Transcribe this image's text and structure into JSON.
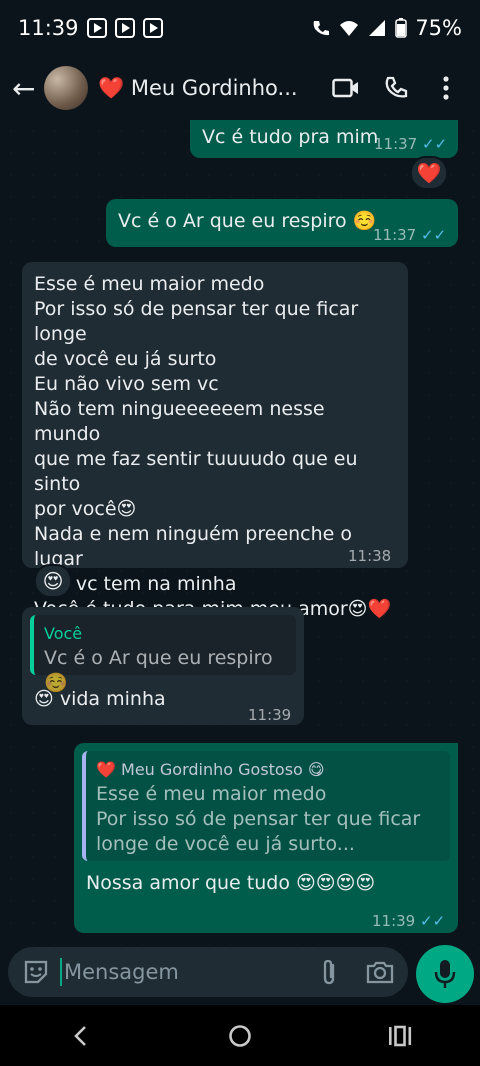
{
  "status_bar": {
    "time": "11:39",
    "battery": "75%"
  },
  "header": {
    "contact_name": "Meu Gordinho...",
    "heart": "❤️"
  },
  "messages": {
    "m1": {
      "text": "Vc é tudo pra mim",
      "time": "11:37",
      "ticks": "✓✓"
    },
    "m1_reaction": "❤️",
    "m2": {
      "text": "Vc é o Ar que eu respiro ☺️",
      "time": "11:37",
      "ticks": "✓✓"
    },
    "m3": {
      "l1": "Esse é meu maior medo",
      "l2": "Por isso só de pensar ter que ficar longe",
      "l3": "de você eu já surto",
      "l4": "Eu não vivo sem vc",
      "l5": "Não tem ningueeeeeem nesse mundo",
      "l6": "que me faz sentir tuuuudo que eu sinto",
      "l7": "por você😍",
      "l8": "Nada e nem  ninguém preenche o lugar",
      "l9": "que vc tem na minha",
      "l10": "Você é tudo para mim meu amor😍❤️",
      "time": "11:38"
    },
    "m3_reaction": "😍",
    "m4": {
      "quote_author": "Você",
      "quote_text": "Vc é o Ar que eu respiro ☺️",
      "text": "😍 vida minha",
      "time": "11:39"
    },
    "m5": {
      "quote_author": "❤️ Meu Gordinho Gostoso 😋",
      "quote_l1": "Esse é meu maior medo",
      "quote_l2": "Por isso só de pensar ter que ficar",
      "quote_l3": "longe de você eu já surto...",
      "text": "Nossa amor que tudo 😍😍😍😍",
      "time": "11:39",
      "ticks": "✓✓"
    }
  },
  "composer": {
    "placeholder": "Mensagem"
  },
  "icons": {
    "back": "arrow-left-icon",
    "video": "video-camera-icon",
    "call": "phone-icon",
    "menu": "more-vertical-icon",
    "sticker": "sticker-icon",
    "attach": "paperclip-icon",
    "camera": "camera-icon",
    "mic": "microphone-icon"
  },
  "colors": {
    "outgoing": "#005c4b",
    "incoming": "#202c33",
    "accent": "#00a884",
    "ticks": "#53bdeb"
  }
}
